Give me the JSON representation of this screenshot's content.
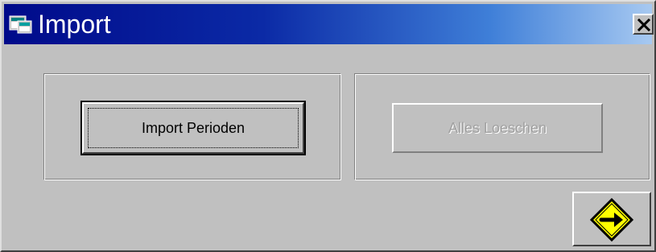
{
  "window": {
    "title": "Import",
    "app_icon": "app-window-icon",
    "close_icon": "close-icon"
  },
  "buttons": {
    "import_periods_label": "Import Perioden",
    "delete_all_label": "Alles Loeschen",
    "delete_all_enabled": false,
    "next_icon": "arrow-right-sign-icon"
  },
  "colors": {
    "titlebar_start": "#000a8a",
    "titlebar_end": "#a7c9f1",
    "face": "#c0c0c0",
    "sign_yellow": "#ffff00"
  }
}
